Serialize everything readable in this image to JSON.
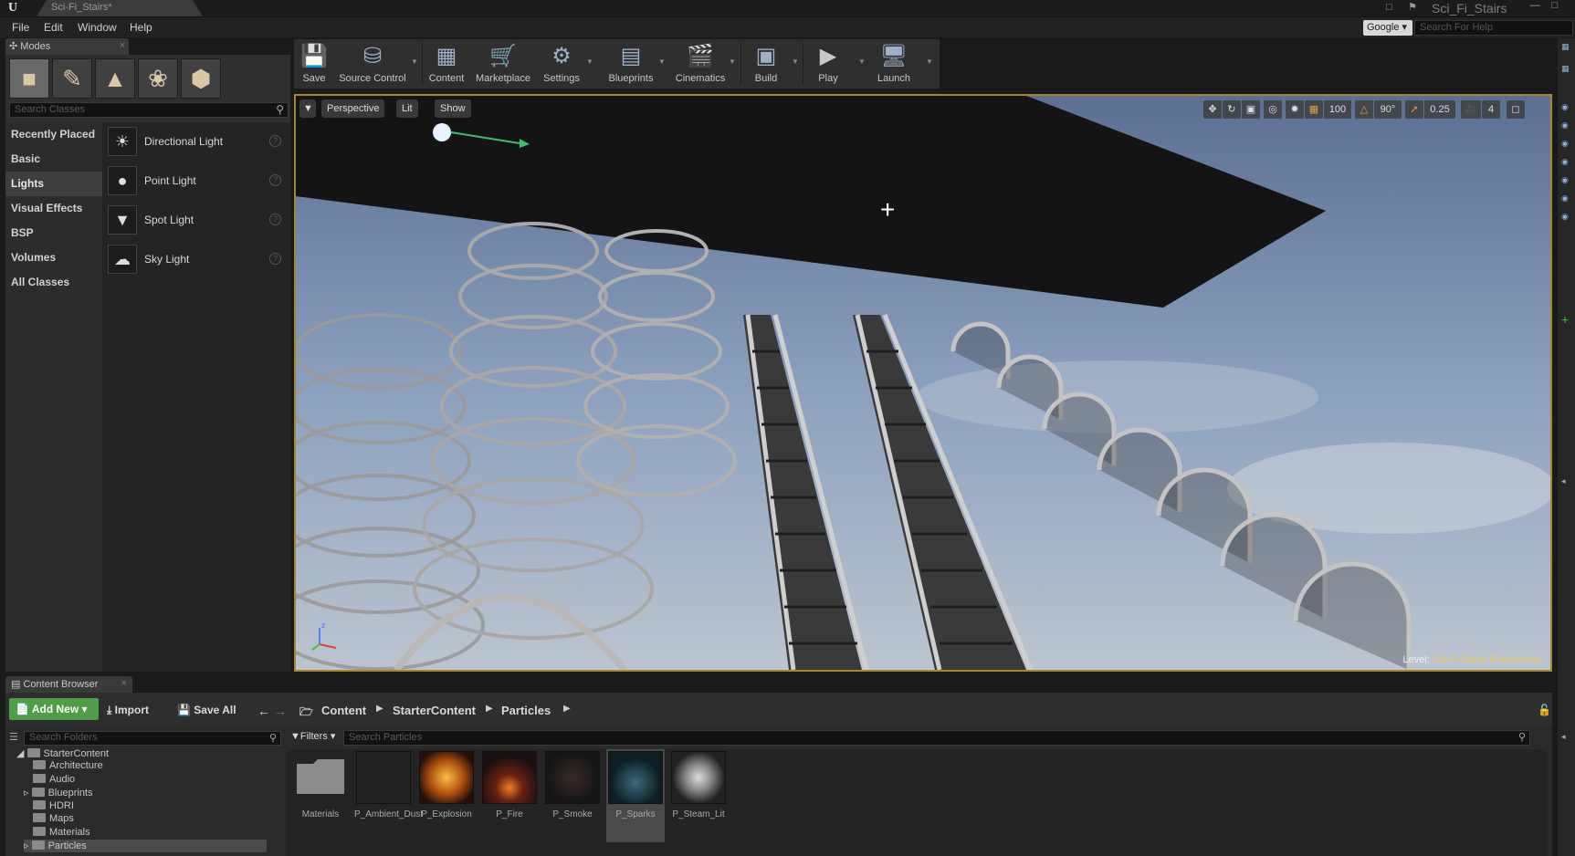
{
  "window": {
    "app_logo": "U",
    "doc_tab": "Sci-Fi_Stairs*",
    "project_name": "Sci_Fi_Stairs"
  },
  "menu": [
    "File",
    "Edit",
    "Window",
    "Help"
  ],
  "help": {
    "search_engine": "Google",
    "search_placeholder": "Search For Help"
  },
  "modes": {
    "tab_label": "Modes",
    "search_placeholder": "Search Classes",
    "categories": [
      "Recently Placed",
      "Basic",
      "Lights",
      "Visual Effects",
      "BSP",
      "Volumes",
      "All Classes"
    ],
    "active_category": "Lights",
    "classes": [
      "Directional Light",
      "Point Light",
      "Spot Light",
      "Sky Light"
    ]
  },
  "toolbar": {
    "buttons": [
      "Save",
      "Source Control",
      "Content",
      "Marketplace",
      "Settings",
      "Blueprints",
      "Cinematics",
      "Build",
      "Play",
      "Launch"
    ]
  },
  "viewport": {
    "view_mode": "Perspective",
    "lighting": "Lit",
    "show": "Show",
    "grid_snap": "100",
    "rotation_snap": "90°",
    "scale_snap": "0.25",
    "camera_speed": "4",
    "level_prefix": "Level:",
    "level_name": "Sci-Fi-Stairs (Persistent)"
  },
  "content_browser": {
    "tab_label": "Content Browser",
    "add_new": "Add New",
    "import": "Import",
    "save_all": "Save All",
    "breadcrumb": [
      "Content",
      "StarterContent",
      "Particles"
    ],
    "folder_search_placeholder": "Search Folders",
    "filters": "Filters",
    "asset_search_placeholder": "Search Particles",
    "tree": [
      "StarterContent",
      "Architecture",
      "Audio",
      "Blueprints",
      "HDRI",
      "Maps",
      "Materials",
      "Particles"
    ],
    "assets": [
      "Materials",
      "P_Ambient_Dust",
      "P_Explosion",
      "P_Fire",
      "P_Smoke",
      "P_Sparks",
      "P_Steam_Lit"
    ],
    "selected_asset": "P_Sparks"
  },
  "colors": {
    "viewport_border": "#a5862f",
    "add_new_green": "#4d9e44",
    "level_name": "#e9c860"
  }
}
